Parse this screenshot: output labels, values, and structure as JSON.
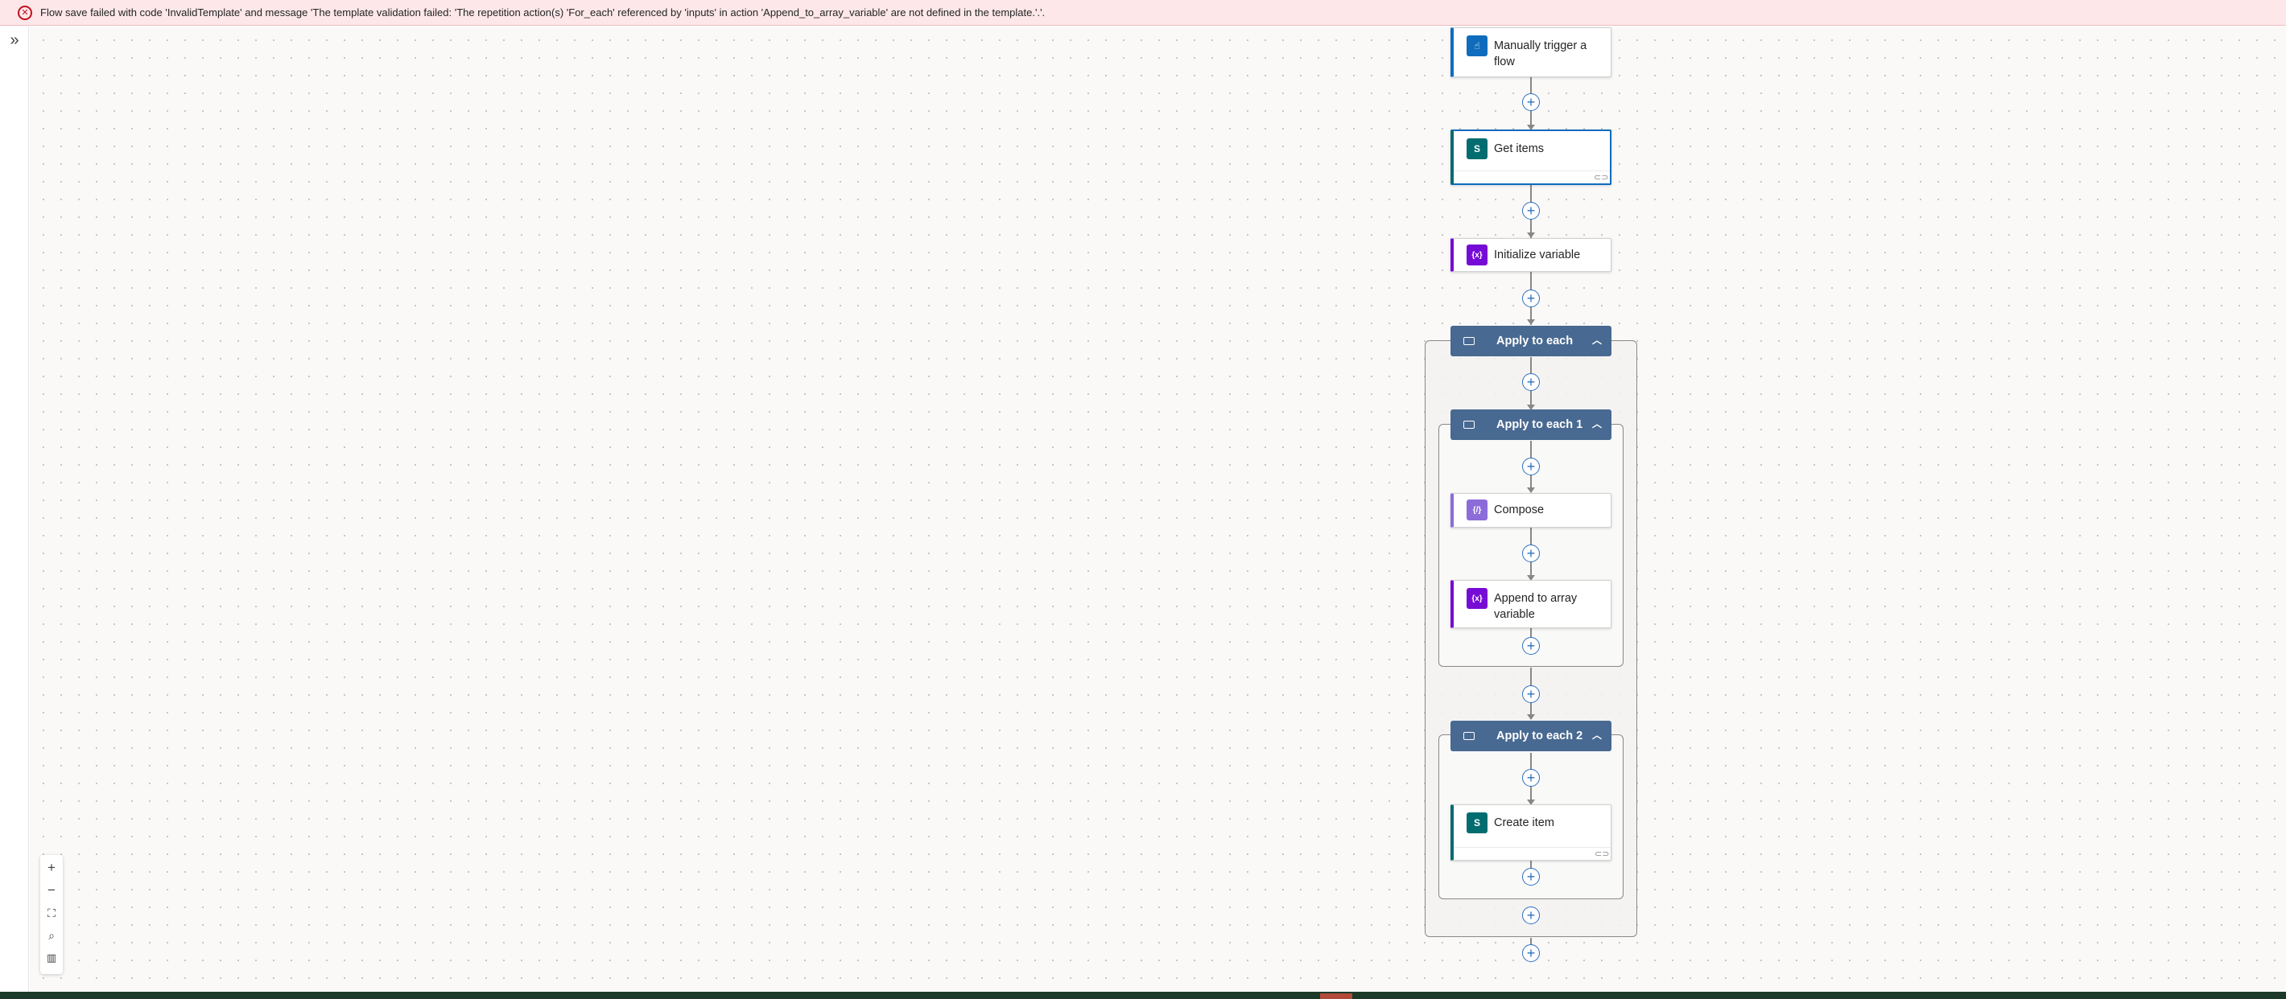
{
  "banner": {
    "message": "Flow save failed with code 'InvalidTemplate' and message 'The template validation failed: 'The repetition action(s) 'For_each' referenced by 'inputs' in action 'Append_to_array_variable' are not defined in the template.'.'."
  },
  "rail": {
    "expand_glyph": "»"
  },
  "actions": {
    "trigger": "Manually trigger a flow",
    "get_items": "Get items",
    "init_variable": "Initialize variable",
    "apply_to_each": "Apply to each",
    "apply_to_each_1": "Apply to each 1",
    "compose": "Compose",
    "append_to_array": "Append to array variable",
    "apply_to_each_2": "Apply to each 2",
    "create_item": "Create item"
  },
  "icons": {
    "trigger": "hand-pointer-icon",
    "sharepoint": "sharepoint-icon",
    "variable": "variable-icon",
    "compose": "compose-icon",
    "loop": "loop-icon",
    "link": "link-icon"
  },
  "colors": {
    "error_bg": "#fde7e9",
    "error_red": "#c50f1f",
    "scope_header": "#486991",
    "trigger_blue": "#0f6cbd",
    "sharepoint_teal": "#036c70",
    "variable_purple": "#770bd6",
    "compose_purple": "#8c6cd9",
    "plus_blue": "#2d6fc2"
  },
  "zoom": {
    "zoom_in": "+",
    "zoom_out": "−"
  }
}
